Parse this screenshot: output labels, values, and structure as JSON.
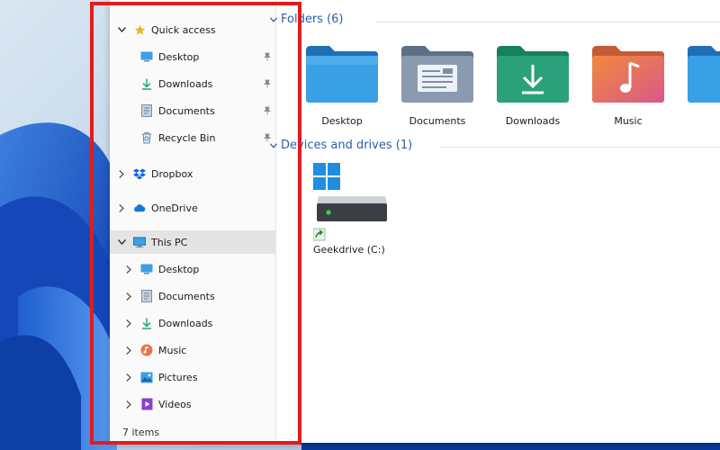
{
  "nav": {
    "quick_access": "Quick access",
    "quick_items": [
      {
        "label": "Desktop",
        "icon": "desktop-icon"
      },
      {
        "label": "Downloads",
        "icon": "download-arrow-icon"
      },
      {
        "label": "Documents",
        "icon": "documents-icon"
      },
      {
        "label": "Recycle Bin",
        "icon": "recycle-bin-icon"
      }
    ],
    "dropbox": "Dropbox",
    "onedrive": "OneDrive",
    "this_pc": "This PC",
    "pc_items": [
      {
        "label": "Desktop",
        "icon": "desktop-icon"
      },
      {
        "label": "Documents",
        "icon": "documents-icon"
      },
      {
        "label": "Downloads",
        "icon": "download-arrow-icon"
      },
      {
        "label": "Music",
        "icon": "music-icon"
      },
      {
        "label": "Pictures",
        "icon": "pictures-icon"
      },
      {
        "label": "Videos",
        "icon": "videos-icon"
      }
    ],
    "status": "7 items"
  },
  "content": {
    "folders_header": "Folders (6)",
    "folders": [
      {
        "label": "Desktop",
        "color": "#2f8fd8"
      },
      {
        "label": "Documents",
        "color": "#7d8fa6"
      },
      {
        "label": "Downloads",
        "color": "#2aa17a"
      },
      {
        "label": "Music",
        "color": "#e8744a"
      }
    ],
    "devices_header": "Devices and drives (1)",
    "drive_label": "Geekdrive (C:)"
  },
  "colors": {
    "highlight": "#e31b1b",
    "section_title": "#2a5fa8",
    "selected_row": "#e4e4e4"
  }
}
